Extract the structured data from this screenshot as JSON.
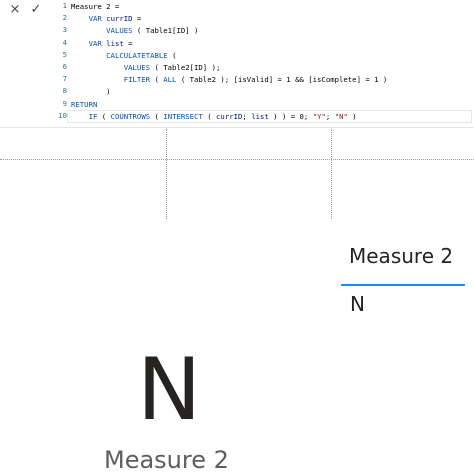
{
  "formula_bar": {
    "cancel_icon": "×",
    "commit_icon": "✓",
    "line_numbers": [
      "1",
      "2",
      "3",
      "4",
      "5",
      "6",
      "7",
      "8",
      "9",
      "10"
    ],
    "lines": [
      [
        {
          "t": "Measure 2 =",
          "c": ""
        }
      ],
      [
        {
          "t": "    ",
          "c": ""
        },
        {
          "t": "VAR",
          "c": "k"
        },
        {
          "t": " ",
          "c": ""
        },
        {
          "t": "currID",
          "c": "v"
        },
        {
          "t": " =",
          "c": ""
        }
      ],
      [
        {
          "t": "        ",
          "c": ""
        },
        {
          "t": "VALUES",
          "c": "k"
        },
        {
          "t": " ( Table1[ID] )",
          "c": ""
        }
      ],
      [
        {
          "t": "    ",
          "c": ""
        },
        {
          "t": "VAR",
          "c": "k"
        },
        {
          "t": " ",
          "c": ""
        },
        {
          "t": "list",
          "c": "v"
        },
        {
          "t": " =",
          "c": ""
        }
      ],
      [
        {
          "t": "        ",
          "c": ""
        },
        {
          "t": "CALCULATETABLE",
          "c": "k"
        },
        {
          "t": " (",
          "c": ""
        }
      ],
      [
        {
          "t": "            ",
          "c": ""
        },
        {
          "t": "VALUES",
          "c": "k"
        },
        {
          "t": " ( Table2[ID] );",
          "c": ""
        }
      ],
      [
        {
          "t": "            ",
          "c": ""
        },
        {
          "t": "FILTER",
          "c": "k"
        },
        {
          "t": " ( ",
          "c": ""
        },
        {
          "t": "ALL",
          "c": "k"
        },
        {
          "t": " ( Table2 ); [isValid] = 1 && [isComplete] = 1 )",
          "c": ""
        }
      ],
      [
        {
          "t": "        )",
          "c": ""
        }
      ],
      [
        {
          "t": "RETURN",
          "c": "k"
        }
      ],
      [
        {
          "t": "    ",
          "c": ""
        },
        {
          "t": "IF",
          "c": "k"
        },
        {
          "t": " ( ",
          "c": ""
        },
        {
          "t": "COUNTROWS",
          "c": "k"
        },
        {
          "t": " ( ",
          "c": ""
        },
        {
          "t": "INTERSECT",
          "c": "k"
        },
        {
          "t": " ( ",
          "c": ""
        },
        {
          "t": "currID",
          "c": "v"
        },
        {
          "t": "; ",
          "c": ""
        },
        {
          "t": "list",
          "c": "v"
        },
        {
          "t": " ) ) = 0; ",
          "c": ""
        },
        {
          "t": "\"Y\"",
          "c": "s"
        },
        {
          "t": "; ",
          "c": ""
        },
        {
          "t": "\"N\"",
          "c": "s"
        },
        {
          "t": " )",
          "c": ""
        }
      ]
    ]
  },
  "card": {
    "value": "N",
    "title": "Measure 2"
  },
  "table_visual": {
    "header": "Measure 2",
    "cell": "N"
  },
  "colors": {
    "keyword": "#0451a5",
    "variable": "#001080",
    "string": "#a31515",
    "line_number": "#237893",
    "accent": "#118dff"
  }
}
